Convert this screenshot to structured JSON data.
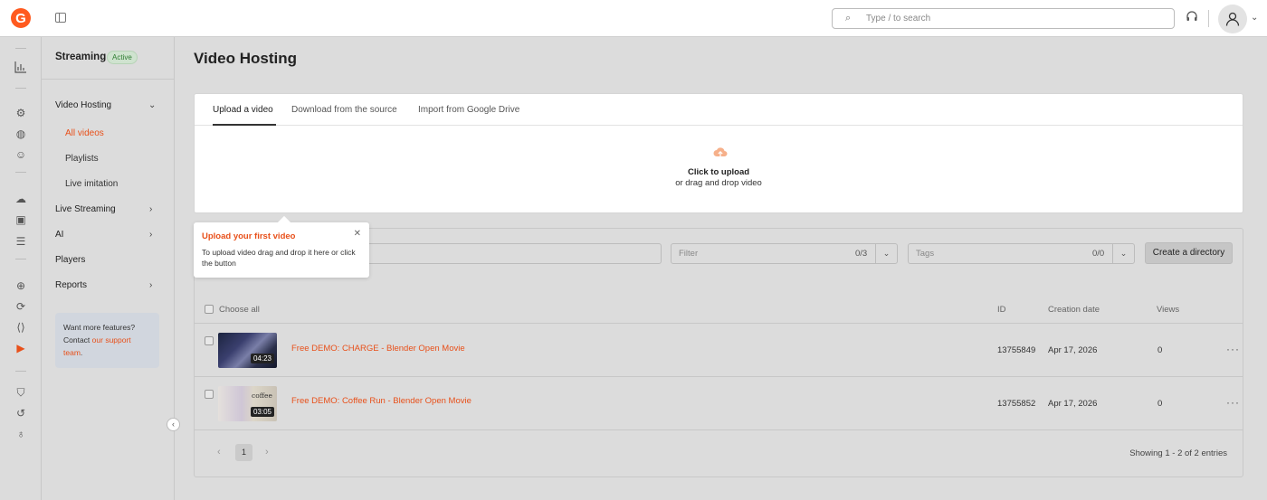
{
  "topbar": {
    "logo": "G",
    "search_placeholder": "Type / to search"
  },
  "icons": {
    "rail": [
      "analytics-icon",
      "cdn-icon",
      "streaming-icon",
      "ai-icon",
      "cloud-icon",
      "video-icon",
      "storage-icon",
      "dns-icon",
      "fastedge-icon",
      "waap-icon",
      "hosting-icon",
      "security-icon",
      "ddos-icon",
      "idea-icon"
    ]
  },
  "sidenav": {
    "title": "Streaming",
    "badge": "Active",
    "video_hosting": "Video Hosting",
    "all_videos": "All videos",
    "playlists": "Playlists",
    "live_imitation": "Live imitation",
    "live_streaming": "Live Streaming",
    "ai": "AI",
    "players": "Players",
    "reports": "Reports",
    "promo_line1": "Want more features? Contact",
    "promo_link": "our support team",
    "promo_end": "."
  },
  "main": {
    "title": "Video Hosting",
    "tabs": [
      "Upload a video",
      "Download from the source",
      "Import from Google Drive"
    ],
    "upload_title": "Click to upload",
    "upload_sub": "or drag and drop video",
    "filter_placeholder": "Filter",
    "filter_count": "0/3",
    "tags_placeholder": "Tags",
    "tags_count": "0/0",
    "create_directory": "Create a directory",
    "choose_all": "Choose all",
    "col_id": "ID",
    "col_date": "Creation date",
    "col_views": "Views",
    "videos": [
      {
        "title": "Free DEMO: CHARGE - Blender Open Movie",
        "duration": "04:23",
        "id": "13755849",
        "date": "Apr 17, 2026",
        "views": "0"
      },
      {
        "title": "Free DEMO: Coffee Run - Blender Open Movie",
        "duration": "03:05",
        "id": "13755852",
        "date": "Apr 17, 2026",
        "views": "0"
      }
    ],
    "page": "1",
    "showing": "Showing 1 - 2 of 2 entries",
    "thumb2_text": "coffee"
  },
  "tooltip": {
    "title": "Upload your first video",
    "body": "To upload video drag and drop it here or click the button"
  },
  "colors": {
    "accent": "#e8501a",
    "active_badge": "#2e7d32"
  }
}
